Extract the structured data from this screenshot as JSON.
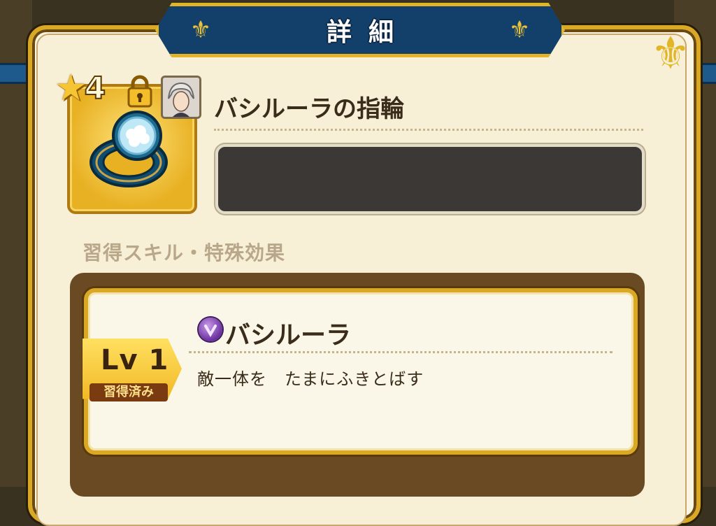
{
  "header": {
    "title": "詳細"
  },
  "item": {
    "rarity": "4",
    "name": "バシルーラの指輪",
    "icon": "sky-crystal-ring-icon",
    "lock_icon": "lock-icon",
    "character_icon": "character-portrait-icon"
  },
  "section": {
    "label": "習得スキル・特殊効果"
  },
  "skill": {
    "name": "バシルーラ",
    "icon": "purple-skill-orb-icon",
    "description": "敵一体を　たまにふきとばす",
    "level": "Lv 1",
    "status": "習得済み"
  },
  "colors": {
    "banner": "#13406a",
    "gold_border": "#d9a824",
    "panel": "#fbf5e3",
    "desc_box": "#3b3835",
    "skill_frame": "#6a4a22"
  }
}
